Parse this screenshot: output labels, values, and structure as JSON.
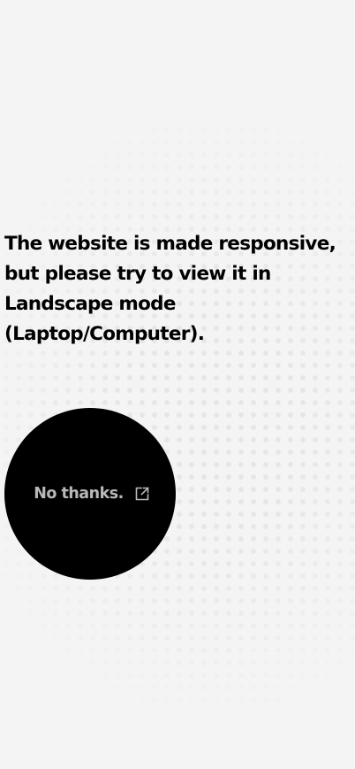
{
  "prompt": {
    "message": "The website is made responsive, but please try to view it in Landscape mode (Laptop/Computer).",
    "dismiss_label": "No thanks.",
    "dismiss_icon": "external-link-icon"
  },
  "colors": {
    "background": "#f4f4f4",
    "circle": "#000000",
    "button_text": "#b8b8b8",
    "message_text": "#000000"
  }
}
